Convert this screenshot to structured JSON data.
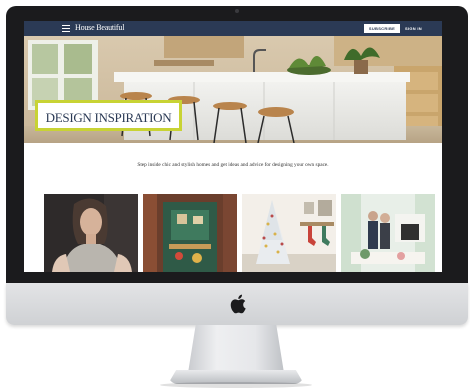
{
  "header": {
    "site_title": "House Beautiful",
    "subscribe_label": "SUBSCRIBE",
    "signin_label": "SIGN IN",
    "menu_icon": "hamburger-menu-icon"
  },
  "hero": {
    "title": "DESIGN INSPIRATION",
    "accent_color": "#c8d334"
  },
  "intro": {
    "tagline": "Step inside chic and stylish homes and get ideas and advice for designing your own space."
  },
  "cards": [
    {
      "subject": "celebrity portrait in sweater"
    },
    {
      "subject": "green hallway interior"
    },
    {
      "subject": "white christmas tree with stockings"
    },
    {
      "subject": "two people in bright living room"
    }
  ],
  "colors": {
    "header_bg": "#2b3a55",
    "title_text": "#2b3a55",
    "bezel": "#1b1b1d"
  },
  "device": {
    "logo": "apple-logo-icon"
  }
}
